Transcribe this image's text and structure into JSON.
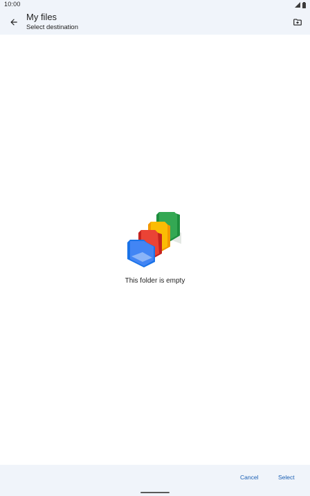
{
  "status_bar": {
    "time": "10:00",
    "icons": [
      "signal-icon",
      "battery-icon"
    ]
  },
  "app_bar": {
    "title": "My files",
    "subtitle": "Select destination",
    "back_icon": "arrow-back-icon",
    "new_folder_icon": "new-folder-icon"
  },
  "empty_state": {
    "illustration": "empty-folders-illustration",
    "message": "This folder is empty"
  },
  "actions": {
    "cancel_label": "Cancel",
    "select_label": "Select"
  },
  "colors": {
    "surface": "#f0f4fa",
    "accent": "#1a5fb4",
    "folder_blue": "#4285f4",
    "folder_red": "#ea4335",
    "folder_yellow": "#fbbc04",
    "folder_green": "#34a853"
  }
}
